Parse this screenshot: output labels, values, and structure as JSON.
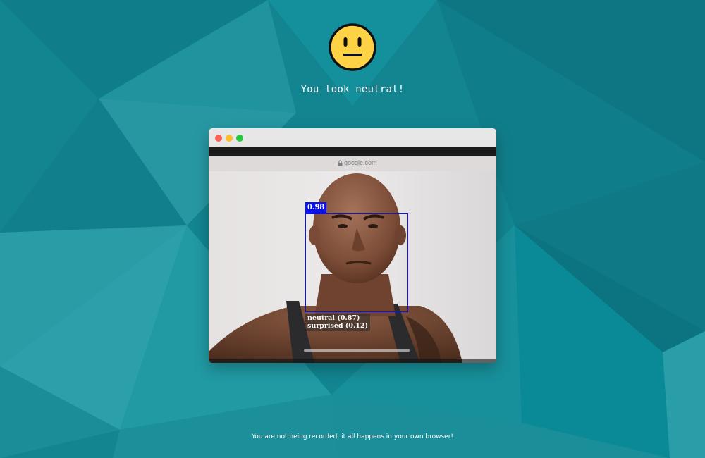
{
  "header": {
    "emoji_icon": "neutral-face-icon",
    "message": "You look neutral!"
  },
  "window": {
    "url": "google.com",
    "lock_icon": "lock-icon",
    "detection": {
      "score": "0.98",
      "expressions": [
        "neutral (0.87)",
        "surprised (0.12)"
      ]
    }
  },
  "footer": {
    "text": "You are not being recorded, it all happens in your own browser!"
  },
  "colors": {
    "background": "#128591",
    "box": "#0a12f0",
    "emoji_fill": "#fdd244"
  }
}
